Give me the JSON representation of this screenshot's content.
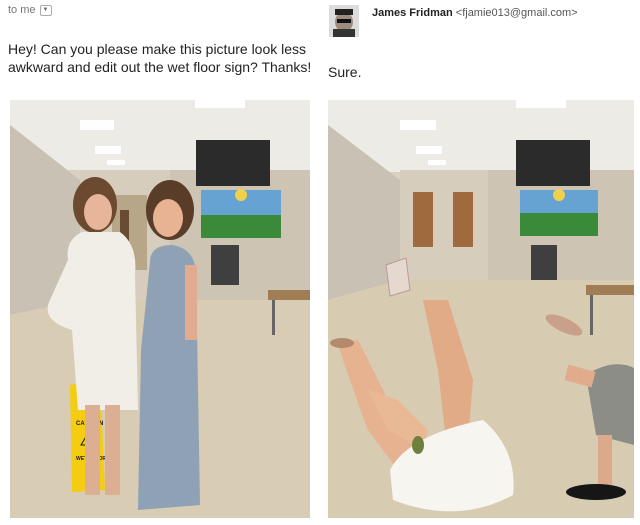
{
  "left": {
    "to_label": "to me",
    "request_text": "Hey! Can you please make this picture look less awkward and edit out the wet floor sign? Thanks!",
    "sign_text": {
      "caution": "CAUTION",
      "wet_floor": "WET FLOOR"
    }
  },
  "right": {
    "sender_name": "James Fridman",
    "sender_email": "<fjamie013@gmail.com>",
    "reply_text": "Sure."
  }
}
